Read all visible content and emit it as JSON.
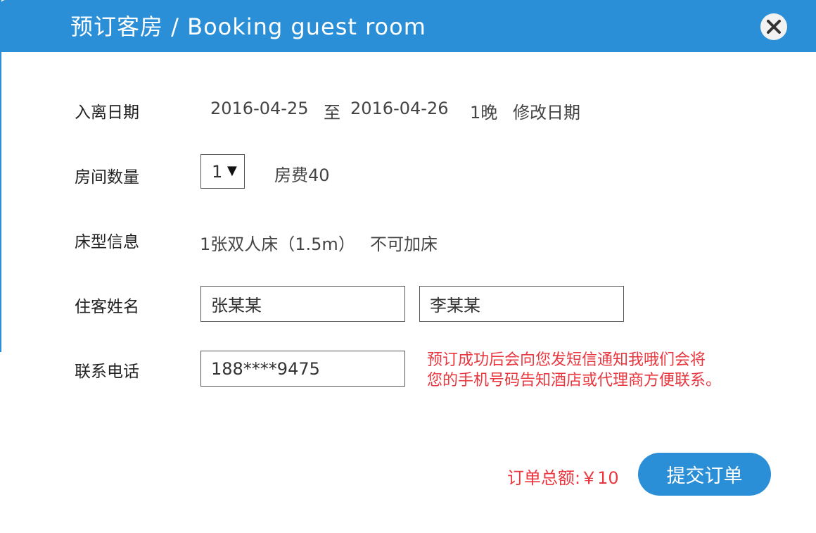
{
  "header": {
    "title": "预订客房 /  Booking guest room"
  },
  "dates": {
    "label": "入离日期",
    "check_in": "2016-04-25",
    "separator": "至",
    "check_out": "2016-04-26",
    "nights": "1晚",
    "modify_link": "修改日期"
  },
  "rooms": {
    "label": "房间数量",
    "selected_count": "1",
    "fee": "房费40"
  },
  "bed": {
    "label": "床型信息",
    "info": "1张双人床（1.5m）",
    "extra_bed": "不可加床"
  },
  "guests": {
    "label": "住客姓名",
    "guest1": "张某某",
    "guest2": "李某某"
  },
  "contact": {
    "label": "联系电话",
    "phone": "188****9475",
    "notice_line1": "预订成功后会向您发短信通知我哦们会将",
    "notice_line2": "您的手机号码告知酒店或代理商方便联系。"
  },
  "footer": {
    "total": "订单总额:￥10",
    "submit_label": "提交订单"
  },
  "colors": {
    "primary": "#2a8fd6",
    "alert_red": "#e8373f",
    "text": "#333333"
  },
  "icons": {
    "close": "close-icon",
    "dropdown": "triangle-down-icon"
  }
}
